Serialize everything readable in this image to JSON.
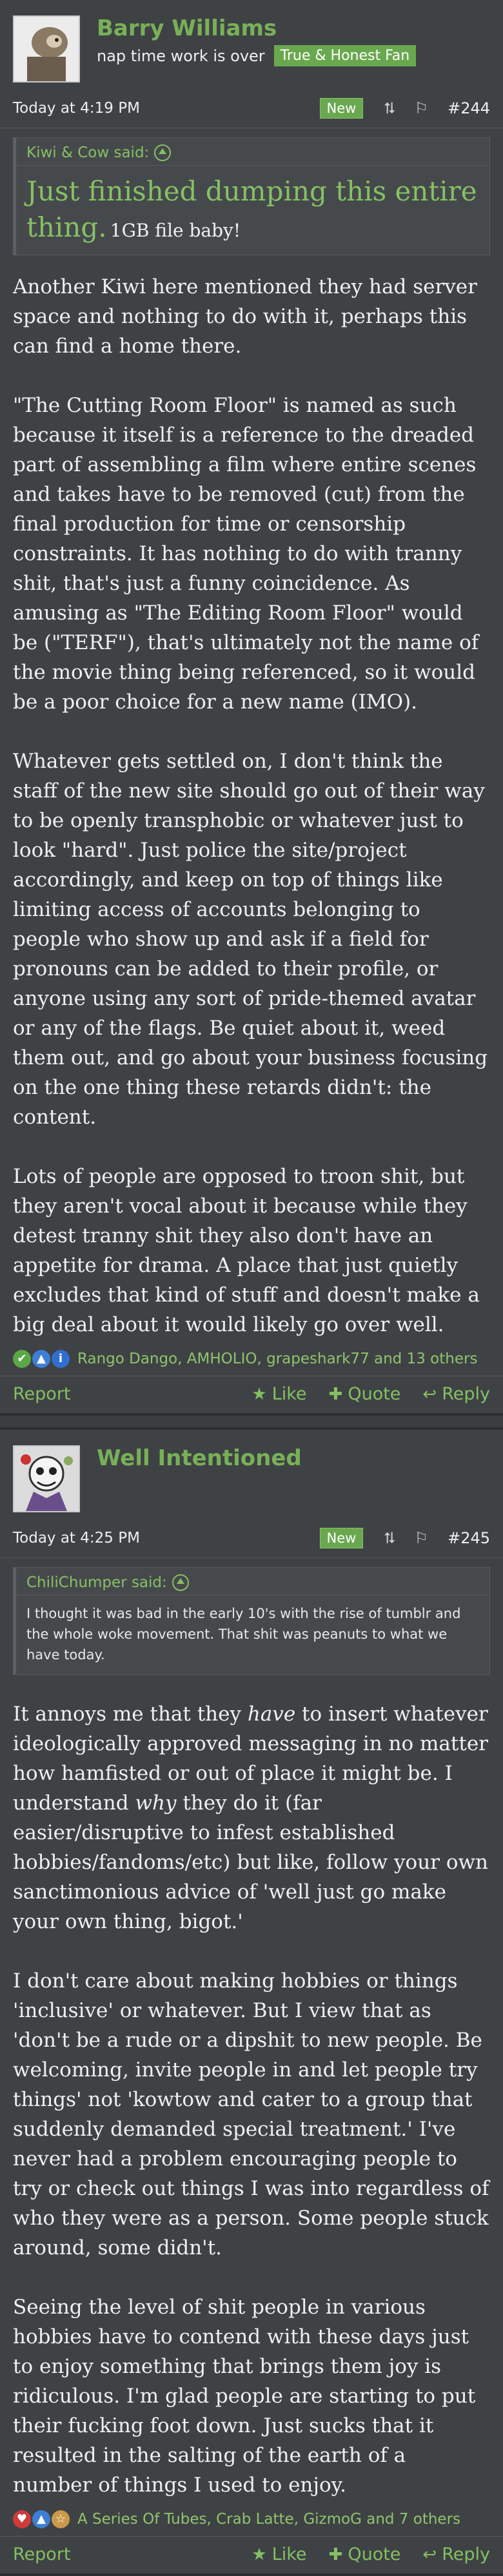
{
  "post1": {
    "username": "Barry Williams",
    "tagline": "nap time work is over",
    "badge": "True & Honest Fan",
    "time": "Today at 4:19 PM",
    "new_label": "New",
    "share_icon": "share-icon",
    "bookmark_icon": "bookmark-icon",
    "number": "#244",
    "quote_author": "Kiwi & Cow said:",
    "quote_big": "Just finished dumping this entire thing.",
    "quote_small": "1GB file baby!",
    "paragraphs": [
      "Another Kiwi here mentioned they had server space and nothing to do with it, perhaps this can find a home there.",
      "\"The Cutting Room Floor\" is named as such because it itself is a reference to the dreaded part of assembling a film where entire scenes and takes have to be removed (cut) from the final production for time or censorship constraints. It has nothing to do with tranny shit, that's just a funny coincidence. As amusing as \"The Editing Room Floor\" would be (\"TERF\"), that's ultimately not the name of the movie thing being referenced, so it would be a poor choice for a new name (IMO).",
      "Whatever gets settled on, I don't think the staff of the new site should go out of their way to be openly transphobic or whatever just to look \"hard\". Just police the site/project accordingly, and keep on top of things like limiting access of accounts belonging to people who show up and ask if a field for pronouns can be added to their profile, or anyone using any sort of pride-themed avatar or any of the flags. Be quiet about it, weed them out, and go about your business focusing on the one thing these retards didn't: the content.",
      "Lots of people are opposed to troon shit, but they aren't vocal about it because while they detest tranny shit they also don't have an appetite for drama. A place that just quietly excludes that kind of stuff and doesn't make a big deal about it would likely go over well."
    ],
    "reactions": "Rango Dango, AMHOLIO, grapeshark77 and 13 others",
    "reaction_colors": [
      "#5aa845",
      "#3d7fd6",
      "#2f6fcf"
    ],
    "report": "Report",
    "like": "Like",
    "quote": "Quote",
    "reply": "Reply"
  },
  "post2": {
    "username": "Well Intentioned",
    "time": "Today at 4:25 PM",
    "new_label": "New",
    "number": "#245",
    "quote_author": "ChiliChumper said:",
    "quote_text": "I thought it was bad in the early 10's with the rise of tumblr and the whole woke movement. That shit was peanuts to what we have today.",
    "p1_a": "It annoys me that they ",
    "p1_em1": "have",
    "p1_b": " to insert whatever ideologically approved messaging in no matter how hamfisted or out of place it might be. I understand ",
    "p1_em2": "why",
    "p1_c": " they do it (far easier/disruptive to infest established hobbies/fandoms/etc) but like, follow your own sanctimonious advice of 'well just go make your own thing, bigot.'",
    "p2": "I don't care about making hobbies or things 'inclusive' or whatever. But I view that as 'don't be a rude or a dipshit to new people. Be welcoming, invite people in and let people try things' not 'kowtow and cater to a group that suddenly demanded special treatment.' I've never had a problem encouraging people to try or check out things I was into regardless of who they were as a person. Some people stuck around, some didn't.",
    "p3": "Seeing the level of shit people in various hobbies have to contend with these days just to enjoy something that brings them joy is ridiculous. I'm glad people are starting to put their fucking foot down. Just sucks that it resulted in the salting of the earth of a number of things I used to enjoy.",
    "reactions": "A Series Of Tubes, Crab Latte, GizmoG and 7 others",
    "reaction_colors": [
      "#d23a3a",
      "#3d7fd6",
      "#c99a4a"
    ],
    "report": "Report",
    "like": "Like",
    "quote": "Quote",
    "reply": "Reply"
  }
}
